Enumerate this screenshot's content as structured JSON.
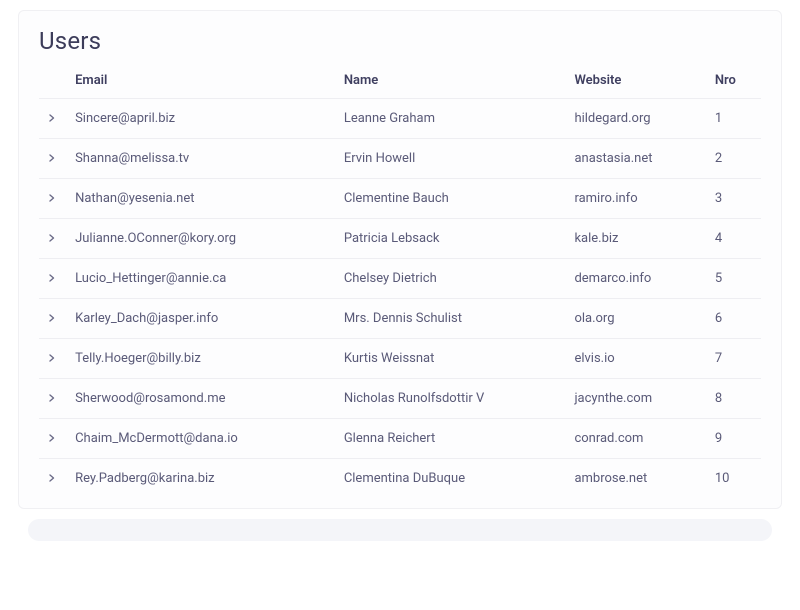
{
  "title": "Users",
  "columns": {
    "email": "Email",
    "name": "Name",
    "website": "Website",
    "nro": "Nro"
  },
  "rows": [
    {
      "email": "Sincere@april.biz",
      "name": "Leanne Graham",
      "website": "hildegard.org",
      "nro": "1"
    },
    {
      "email": "Shanna@melissa.tv",
      "name": "Ervin Howell",
      "website": "anastasia.net",
      "nro": "2"
    },
    {
      "email": "Nathan@yesenia.net",
      "name": "Clementine Bauch",
      "website": "ramiro.info",
      "nro": "3"
    },
    {
      "email": "Julianne.OConner@kory.org",
      "name": "Patricia Lebsack",
      "website": "kale.biz",
      "nro": "4"
    },
    {
      "email": "Lucio_Hettinger@annie.ca",
      "name": "Chelsey Dietrich",
      "website": "demarco.info",
      "nro": "5"
    },
    {
      "email": "Karley_Dach@jasper.info",
      "name": "Mrs. Dennis Schulist",
      "website": "ola.org",
      "nro": "6"
    },
    {
      "email": "Telly.Hoeger@billy.biz",
      "name": "Kurtis Weissnat",
      "website": "elvis.io",
      "nro": "7"
    },
    {
      "email": "Sherwood@rosamond.me",
      "name": "Nicholas Runolfsdottir V",
      "website": "jacynthe.com",
      "nro": "8"
    },
    {
      "email": "Chaim_McDermott@dana.io",
      "name": "Glenna Reichert",
      "website": "conrad.com",
      "nro": "9"
    },
    {
      "email": "Rey.Padberg@karina.biz",
      "name": "Clementina DuBuque",
      "website": "ambrose.net",
      "nro": "10"
    }
  ]
}
